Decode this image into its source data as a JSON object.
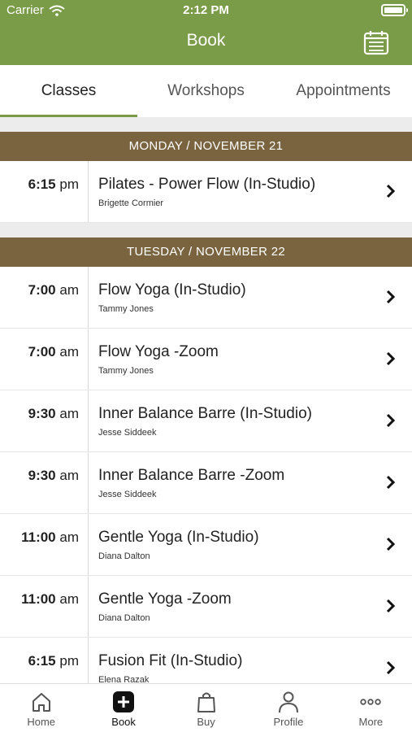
{
  "status_bar": {
    "carrier": "Carrier",
    "time": "2:12 PM"
  },
  "header": {
    "title": "Book",
    "calendar_icon": "calendar-icon"
  },
  "tabs": [
    {
      "label": "Classes",
      "active": true
    },
    {
      "label": "Workshops",
      "active": false
    },
    {
      "label": "Appointments",
      "active": false
    }
  ],
  "days": [
    {
      "header": "MONDAY / NOVEMBER 21",
      "classes": [
        {
          "time": "6:15",
          "ampm": "pm",
          "name": "Pilates - Power Flow (In-Studio)",
          "instructor": "Brigette Cormier"
        }
      ]
    },
    {
      "header": "TUESDAY / NOVEMBER 22",
      "classes": [
        {
          "time": "7:00",
          "ampm": "am",
          "name": "Flow Yoga (In-Studio)",
          "instructor": "Tammy Jones"
        },
        {
          "time": "7:00",
          "ampm": "am",
          "name": "Flow Yoga -Zoom",
          "instructor": "Tammy Jones"
        },
        {
          "time": "9:30",
          "ampm": "am",
          "name": "Inner Balance Barre (In-Studio)",
          "instructor": "Jesse Siddeek"
        },
        {
          "time": "9:30",
          "ampm": "am",
          "name": "Inner Balance Barre -Zoom",
          "instructor": "Jesse Siddeek"
        },
        {
          "time": "11:00",
          "ampm": "am",
          "name": "Gentle Yoga (In-Studio)",
          "instructor": "Diana Dalton"
        },
        {
          "time": "11:00",
          "ampm": "am",
          "name": "Gentle Yoga -Zoom",
          "instructor": "Diana Dalton"
        },
        {
          "time": "6:15",
          "ampm": "pm",
          "name": "Fusion Fit (In-Studio)",
          "instructor": "Elena Razak"
        }
      ]
    }
  ],
  "tab_bar": [
    {
      "label": "Home",
      "icon": "home-icon",
      "active": false
    },
    {
      "label": "Book",
      "icon": "plus-square-icon",
      "active": true
    },
    {
      "label": "Buy",
      "icon": "shopping-bag-icon",
      "active": false
    },
    {
      "label": "Profile",
      "icon": "person-icon",
      "active": false
    },
    {
      "label": "More",
      "icon": "more-dots-icon",
      "active": false
    }
  ],
  "colors": {
    "brand_green": "#7a9b47",
    "day_header_brown": "#7a6440"
  }
}
